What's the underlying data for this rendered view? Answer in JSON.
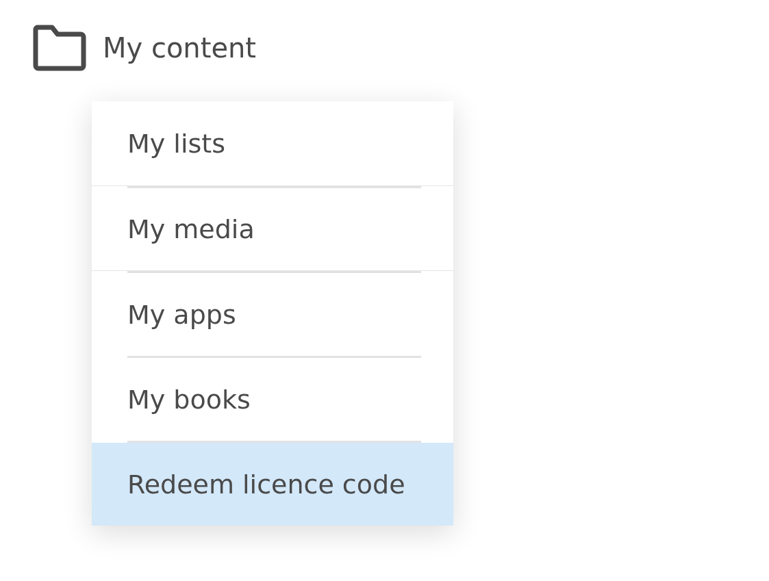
{
  "header": {
    "label": "My content"
  },
  "menu": {
    "items": [
      {
        "label": "My lists",
        "selected": false
      },
      {
        "label": "My media",
        "selected": false
      },
      {
        "label": "My apps",
        "selected": false
      },
      {
        "label": "My books",
        "selected": false
      },
      {
        "label": "Redeem licence code",
        "selected": true
      }
    ]
  }
}
